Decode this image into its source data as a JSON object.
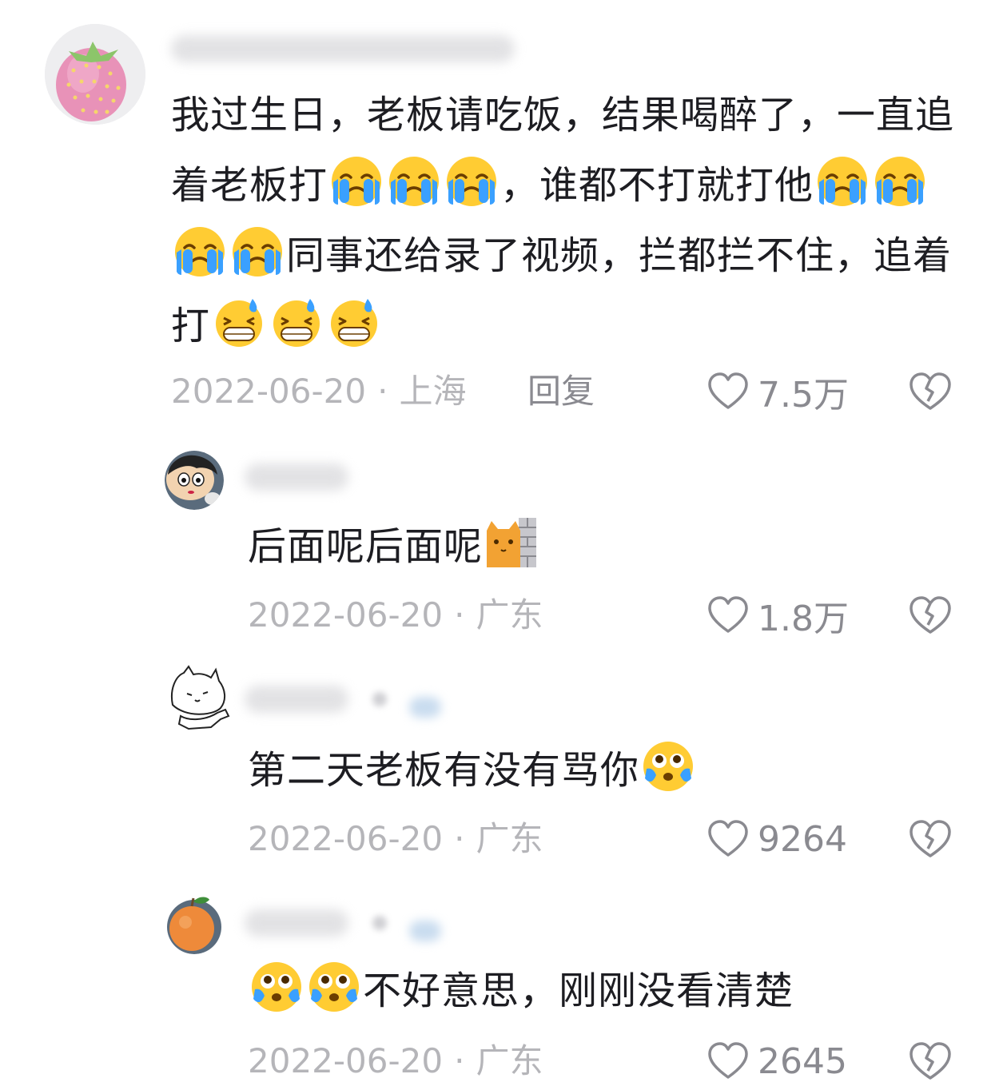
{
  "comments": [
    {
      "segments": [
        {
          "t": "text",
          "v": "我过生日，老板请吃饭，结果喝醉了，一直追着老板打"
        },
        {
          "t": "emoji",
          "v": "loudly-crying-emoji"
        },
        {
          "t": "emoji",
          "v": "loudly-crying-emoji"
        },
        {
          "t": "emoji",
          "v": "loudly-crying-emoji"
        },
        {
          "t": "text",
          "v": "，谁都不打就打他"
        },
        {
          "t": "emoji",
          "v": "loudly-crying-emoji"
        },
        {
          "t": "emoji",
          "v": "loudly-crying-emoji"
        },
        {
          "t": "emoji",
          "v": "loudly-crying-emoji"
        },
        {
          "t": "emoji",
          "v": "loudly-crying-emoji"
        },
        {
          "t": "text",
          "v": "同事还给录了视频，拦都拦不住，追着打"
        },
        {
          "t": "emoji",
          "v": "grinning-sweat-emoji"
        },
        {
          "t": "emoji",
          "v": "grinning-sweat-emoji"
        },
        {
          "t": "emoji",
          "v": "grinning-sweat-emoji"
        }
      ],
      "date": "2022-06-20",
      "separator": "·",
      "location": "上海",
      "reply_label": "回复",
      "likes": "7.5万",
      "avatar_icon": "strawberry-icon"
    },
    {
      "segments": [
        {
          "t": "text",
          "v": "后面呢后面呢"
        },
        {
          "t": "emoji",
          "v": "cat-behind-wall-emoji"
        }
      ],
      "date": "2022-06-20",
      "separator": "·",
      "location": "广东",
      "likes": "1.8万",
      "avatar_icon": "cartoon-boy-icon"
    },
    {
      "segments": [
        {
          "t": "text",
          "v": "第二天老板有没有骂你"
        },
        {
          "t": "emoji",
          "v": "teary-eyed-emoji"
        }
      ],
      "date": "2022-06-20",
      "separator": "·",
      "location": "广东",
      "likes": "9264",
      "avatar_icon": "doodle-cat-icon"
    },
    {
      "segments": [
        {
          "t": "emoji",
          "v": "teary-eyed-emoji"
        },
        {
          "t": "emoji",
          "v": "teary-eyed-emoji"
        },
        {
          "t": "text",
          "v": "不好意思，刚刚没看清楚"
        }
      ],
      "date": "2022-06-20",
      "separator": "·",
      "location": "广东",
      "likes": "2645",
      "avatar_icon": "orange-fruit-icon"
    }
  ],
  "colors": {
    "text": "#1d1d22",
    "meta": "#b5b5b9",
    "action": "#8a8a90"
  }
}
